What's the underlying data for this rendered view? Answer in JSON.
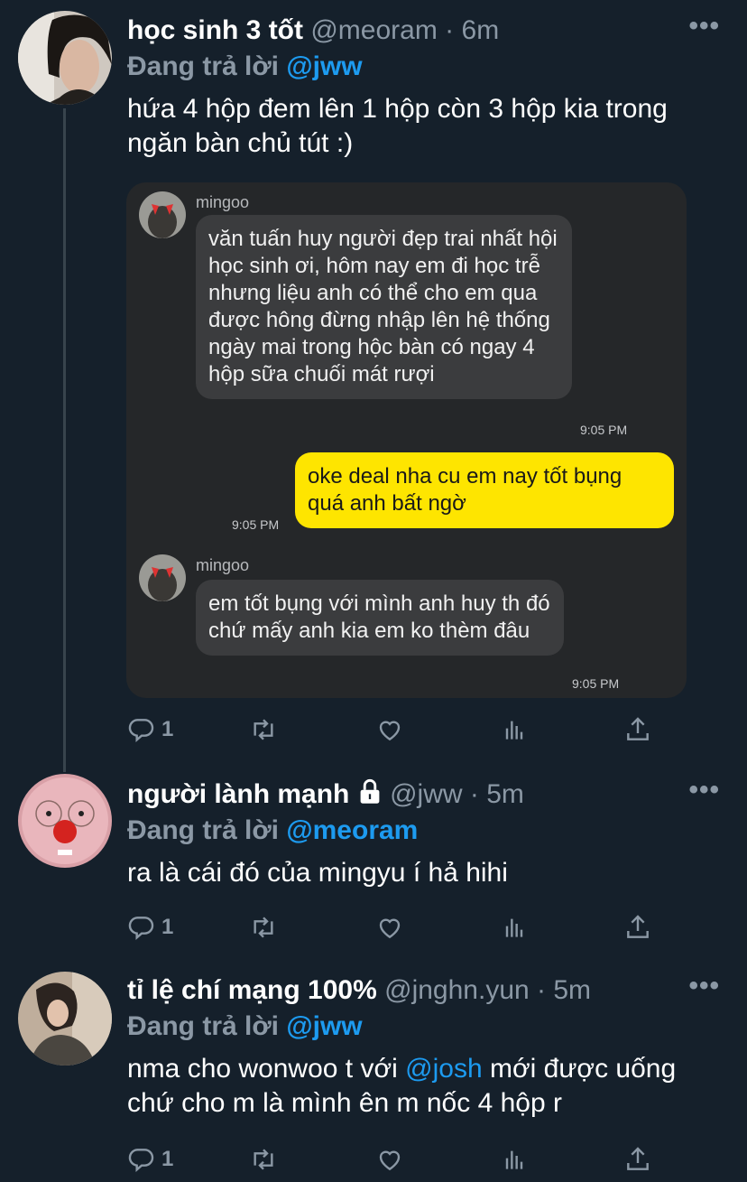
{
  "tweets": [
    {
      "name": "học sinh 3 tốt",
      "handle": "@meoram",
      "time": "6m",
      "reply_prefix": "Đang trả lời",
      "reply_to": "@jww",
      "text": "hứa 4 hộp đem lên 1 hộp còn 3 hộp kia trong ngăn bàn chủ tút :)",
      "reply_count": "1"
    },
    {
      "name": "người lành mạnh",
      "handle": "@jww",
      "time": "5m",
      "reply_prefix": "Đang trả lời",
      "reply_to": "@meoram",
      "text": "ra là cái đó của mingyu í hả hihi",
      "reply_count": "1"
    },
    {
      "name": "tỉ lệ chí mạng 100%",
      "handle": "@jnghn.yun",
      "time": "5m",
      "reply_prefix": "Đang trả lời",
      "reply_to": "@jww",
      "text_before": "nma cho wonwoo t với ",
      "text_mention": "@josh",
      "text_after": " mới được uống chứ cho m là mình ên m nốc 4 hộp r",
      "reply_count": "1"
    }
  ],
  "separator": "·",
  "more_glyph": "•••",
  "chat": {
    "messages": [
      {
        "sender": "mingoo",
        "text": "văn tuấn huy người đẹp trai nhất hội học sinh ơi, hôm nay em đi học trễ nhưng liệu anh có thể cho em qua được hông đừng nhập lên hệ thống ngày mai trong hộc bàn có ngay 4 hộp sữa chuối mát rượi",
        "time": "9:05 PM"
      },
      {
        "sender": "",
        "text": "oke deal nha cu em nay tốt bụng quá anh bất ngờ",
        "time": "9:05 PM"
      },
      {
        "sender": "mingoo",
        "text": "em tốt bụng với mình anh huy th đó chứ mấy anh kia em ko thèm đâu",
        "time": "9:05 PM"
      }
    ]
  },
  "icons": [
    "reply-icon",
    "retweet-icon",
    "like-icon",
    "analytics-icon",
    "share-icon",
    "lock-icon",
    "more-icon"
  ],
  "colors": {
    "background": "#15202b",
    "accent": "#1d9bf0",
    "muted": "#8b98a5",
    "my_bubble": "#fee500"
  }
}
